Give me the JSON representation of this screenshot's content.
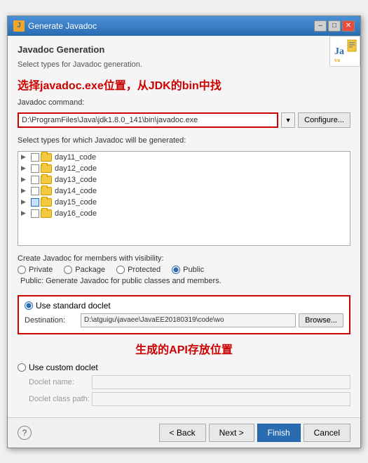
{
  "window": {
    "title": "Generate Javadoc",
    "icon": "J"
  },
  "header": {
    "section_title": "Javadoc Generation",
    "subtitle": "Select types for Javadoc generation.",
    "annotation1": "选择javadoc.exe位置，从JDK的bin中找"
  },
  "command": {
    "label": "Javadoc command:",
    "value": "D:\\ProgramFiles\\Java\\jdk1.8.0_141\\bin\\javadoc.exe",
    "configure_label": "Configure..."
  },
  "types": {
    "label": "Select types for which Javadoc will be generated:",
    "items": [
      {
        "name": "day11_code"
      },
      {
        "name": "day12_code"
      },
      {
        "name": "day13_code"
      },
      {
        "name": "day14_code"
      },
      {
        "name": "day15_code"
      },
      {
        "name": "day16_code"
      }
    ]
  },
  "visibility": {
    "label": "Create Javadoc for members with visibility:",
    "options": [
      "Private",
      "Package",
      "Protected",
      "Public"
    ],
    "selected": "Public",
    "public_note": "Public: Generate Javadoc for public classes and members."
  },
  "standard_doclet": {
    "label": "Use standard doclet",
    "destination_label": "Destination:",
    "destination_value": "D:\\atguigu\\javaee\\JavaEE20180319\\code\\wo",
    "browse_label": "Browse..."
  },
  "annotation2": "生成的API存放位置",
  "custom_doclet": {
    "label": "Use custom doclet",
    "doclet_name_label": "Doclet name:",
    "doclet_classpath_label": "Doclet class path:"
  },
  "buttons": {
    "back": "< Back",
    "next": "Next >",
    "finish": "Finish",
    "cancel": "Cancel"
  }
}
